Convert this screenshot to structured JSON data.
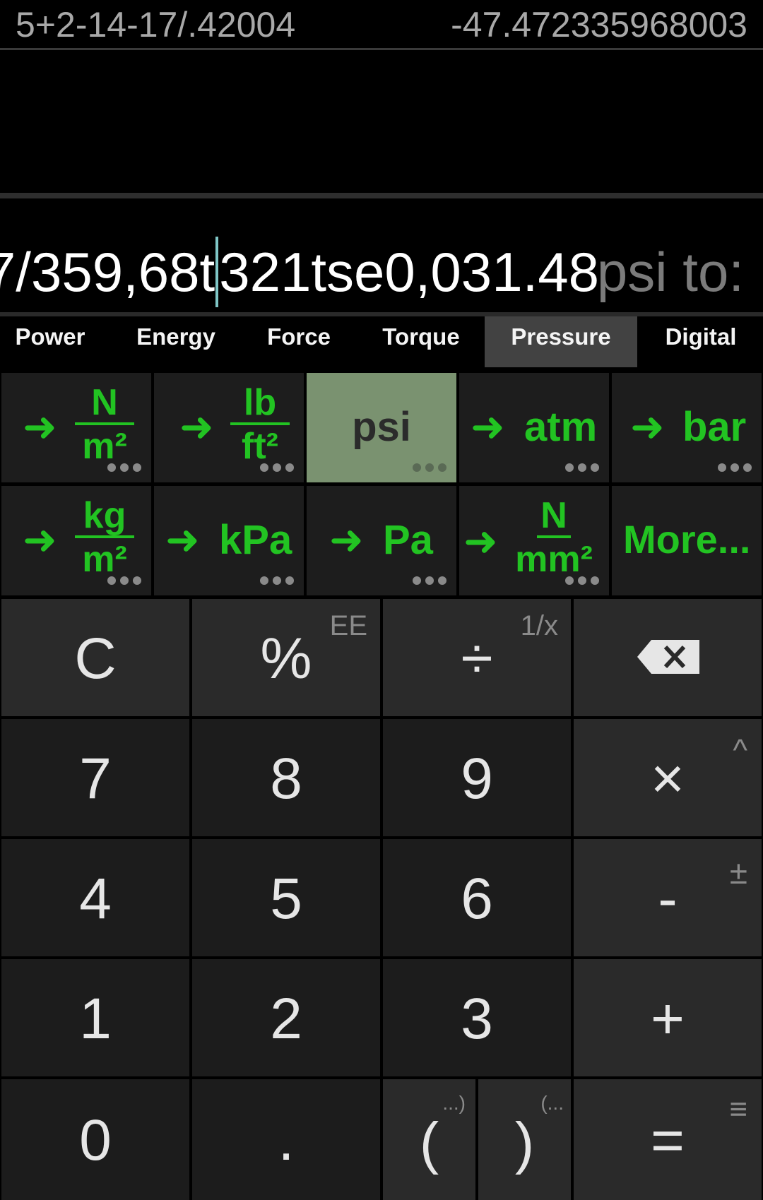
{
  "history": {
    "expression": "5+2-14-17/.42004",
    "result": "-47.472335968003"
  },
  "display": {
    "expression_before_cursor": "7/359,68t",
    "expression_after_cursor": "321tse0,031.48",
    "suffix": "psi to:"
  },
  "tabs": [
    {
      "label": "Power"
    },
    {
      "label": "Energy"
    },
    {
      "label": "Force"
    },
    {
      "label": "Torque"
    },
    {
      "label": "Pressure",
      "active": true
    },
    {
      "label": "Digital"
    }
  ],
  "units": {
    "n_m2": {
      "num": "N",
      "den": "m²"
    },
    "lb_ft2": {
      "num": "lb",
      "den": "ft²"
    },
    "psi": {
      "label": "psi"
    },
    "atm": {
      "label": "atm"
    },
    "bar": {
      "label": "bar"
    },
    "kg_m2": {
      "num": "kg",
      "den": "m²"
    },
    "kpa": {
      "label": "kPa"
    },
    "pa": {
      "label": "Pa"
    },
    "n_mm2": {
      "num": "N",
      "den": "mm²"
    },
    "more": {
      "label": "More..."
    },
    "arrow": "➜"
  },
  "keys": {
    "clear": "C",
    "percent": "%",
    "percent_sub": "EE",
    "divide": "÷",
    "divide_sub": "1/x",
    "backspace": "⌫",
    "seven": "7",
    "eight": "8",
    "nine": "9",
    "multiply": "×",
    "multiply_sub": "^",
    "four": "4",
    "five": "5",
    "six": "6",
    "minus": "-",
    "minus_sub": "±",
    "one": "1",
    "two": "2",
    "three": "3",
    "plus": "+",
    "zero": "0",
    "dot": ".",
    "lparen": "(",
    "lparen_sub": "...)",
    "rparen": ")",
    "rparen_sub": "(...",
    "equals": "=",
    "equals_sub": "≡"
  },
  "colors": {
    "accent_green": "#22c322",
    "selected_unit_bg": "#7a9270",
    "cursor": "#7fc6c6"
  }
}
